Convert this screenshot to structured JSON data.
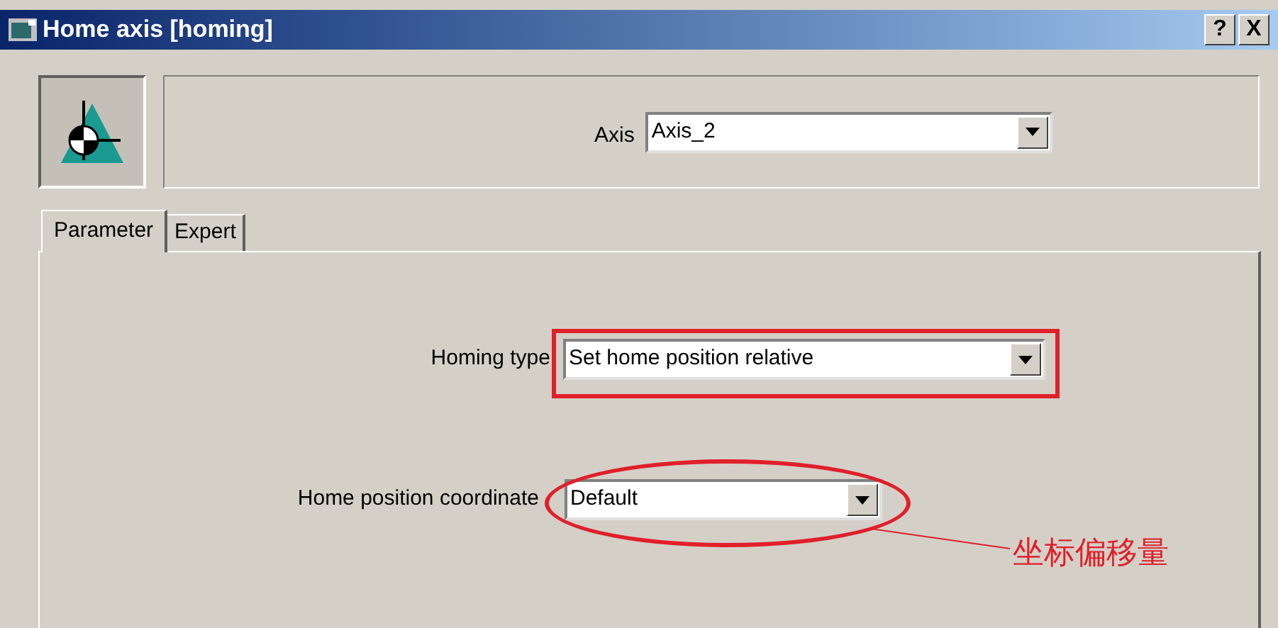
{
  "window": {
    "title": "Home axis [homing]",
    "buttons": [
      "?",
      "X"
    ]
  },
  "axis": {
    "label": "Axis",
    "value": "Axis_2"
  },
  "tabs": [
    {
      "label": "Parameter",
      "selected": true
    },
    {
      "label": "Expert",
      "selected": false
    }
  ],
  "fields": [
    {
      "label": "Homing type",
      "value": "Set home position relative"
    },
    {
      "label": "Home position coordinate",
      "value": "Default"
    }
  ],
  "annotation": {
    "label": "坐标偏移量"
  }
}
